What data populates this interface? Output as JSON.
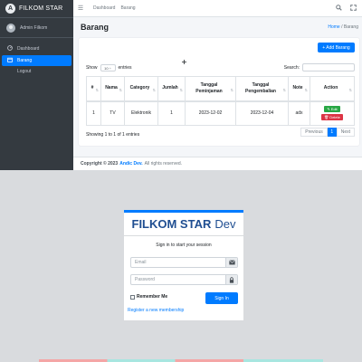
{
  "admin": {
    "brand": "FILKOM STAR",
    "user": "Admin Filkom",
    "sidebar": [
      {
        "icon": "dashboard-icon",
        "label": "Dashboard"
      },
      {
        "icon": "box-icon",
        "label": "Barang"
      },
      {
        "icon": "",
        "label": "Logout"
      }
    ],
    "topnav": [
      "Dashboard",
      "Barang"
    ],
    "page_title": "Barang",
    "breadcrumb": {
      "home": "Home",
      "sep": "/",
      "current": "Barang"
    },
    "add_button": "+ Add Barang",
    "show": {
      "prefix": "Show",
      "value": "10 ÷",
      "suffix": "entries"
    },
    "search_label": "Search:",
    "table": {
      "headers": [
        "#",
        "Nama",
        "Category",
        "Jumlah",
        "Tanggal Peminjaman",
        "Tanggal Pengembalian",
        "Note",
        "Action"
      ],
      "sort_glyph": "⇅",
      "rows": [
        {
          "no": "1",
          "nama": "TV",
          "category": "Elektronik",
          "jumlah": "1",
          "pinjam": "2023-12-02",
          "kembali": "2023-12-04",
          "note": "adx",
          "edit": "✎ Edit",
          "delete": "🗑 Delete"
        }
      ]
    },
    "info": "Showing 1 to 1 of 1 entries",
    "pager": {
      "prev": "Previous",
      "current": "1",
      "next": "Next"
    },
    "footer": {
      "prefix": "Copyright © 2023",
      "link": "Andic Dev.",
      "rights": "All rights reserved."
    }
  },
  "login": {
    "title_bold": "FILKOM STAR",
    "title_light": "Dev",
    "message": "Sign in to start your session",
    "email_placeholder": "Email",
    "password_placeholder": "Password",
    "remember": "Remember Me",
    "signin": "Sign In",
    "register": "Register a new membership"
  },
  "colors": {
    "primary": "#007bff",
    "sidebar": "#343a40",
    "title": "#1f4e91",
    "edit": "#28a745",
    "delete": "#dc3545"
  }
}
